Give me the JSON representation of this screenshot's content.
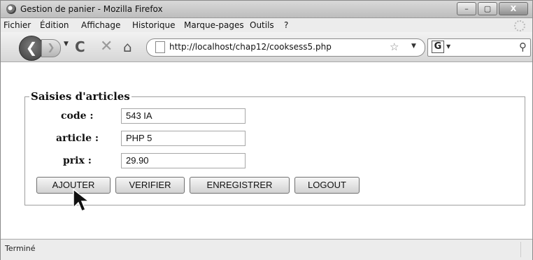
{
  "window": {
    "title": "Gestion de panier - Mozilla Firefox",
    "controls": [
      "–",
      "▢",
      "X"
    ]
  },
  "menu": {
    "items": [
      "Fichier",
      "Édition",
      "Affichage",
      "Historique",
      "Marque-pages",
      "Outils",
      "?"
    ]
  },
  "toolbar": {
    "url": "http://localhost/chap12/cooksess5.php",
    "search_engine_label": "G"
  },
  "form": {
    "legend": "Saisies d'articles",
    "fields": [
      {
        "label": "code :",
        "value": "543 IA"
      },
      {
        "label": "article :",
        "value": "PHP 5"
      },
      {
        "label": "prix :",
        "value": "29.90"
      }
    ],
    "buttons": [
      "AJOUTER",
      "VERIFIER",
      "ENREGISTRER",
      "LOGOUT"
    ]
  },
  "status": {
    "text": "Terminé"
  },
  "icons": [
    "firefox-icon",
    "back-arrow-icon",
    "forward-arrow-icon",
    "reload-icon",
    "stop-icon",
    "home-icon",
    "page-icon",
    "bookmark-star-icon",
    "google-icon",
    "search-magnifier-icon",
    "mouse-cursor-icon"
  ]
}
